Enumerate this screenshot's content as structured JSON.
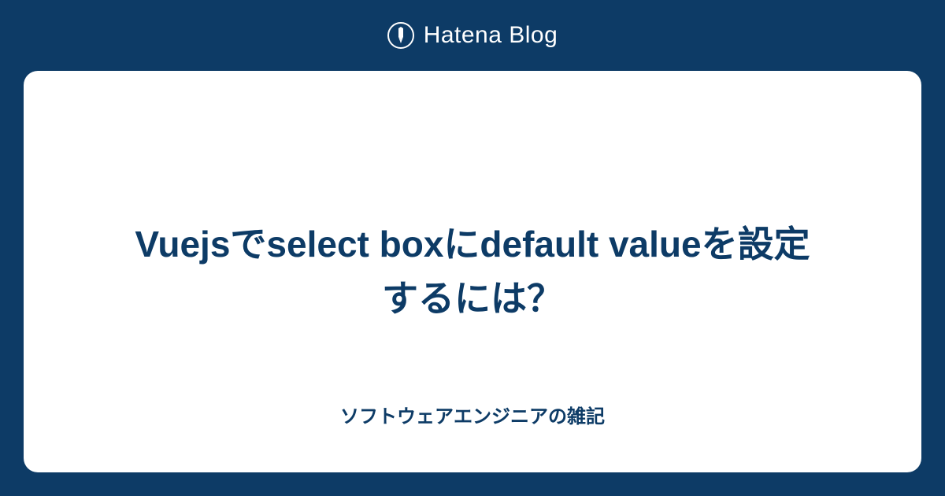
{
  "header": {
    "brand": "Hatena Blog"
  },
  "card": {
    "title": "Vuejsでselect boxにdefault valueを設定するには？",
    "subtitle": "ソフトウェアエンジニアの雑記"
  }
}
